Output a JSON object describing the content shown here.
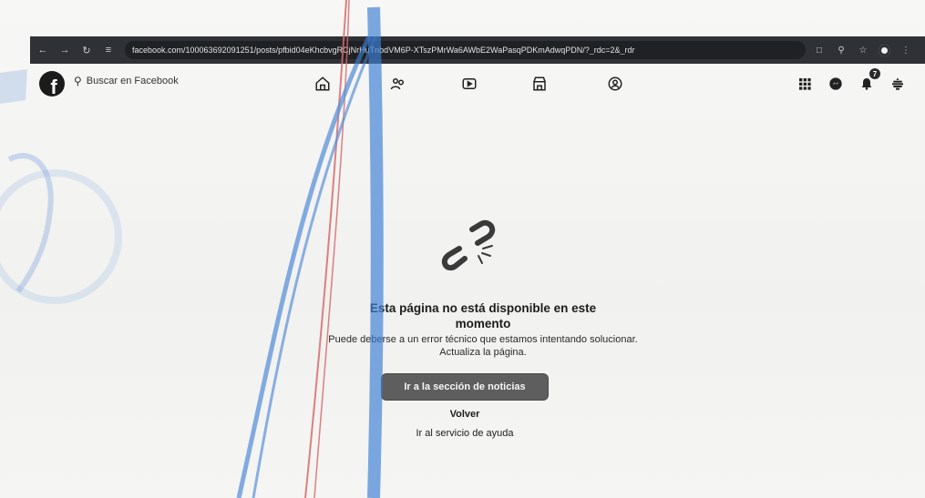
{
  "browser": {
    "url": "facebook.com/100063692091251/posts/pfbid04eKhcbvgRCjNrHuTnbdVM6P-XTszPMrWa6AWbE2WaPasqPDKmAdwqPDN/?_rdc=2&_rdr",
    "back_icon": "back-arrow-icon",
    "forward_icon": "forward-arrow-icon",
    "reload_icon": "reload-icon",
    "site_info_icon": "site-settings-icon",
    "right_icons": [
      "open-in-app-icon",
      "zoom-icon",
      "bookmark-star-icon",
      "profile-icon",
      "menu-icon"
    ]
  },
  "facebook": {
    "logo_letter": "f",
    "search_placeholder": "Buscar en Facebook",
    "nav_icons": [
      "home-icon",
      "friends-icon",
      "video-icon",
      "marketplace-icon",
      "groups-icon"
    ],
    "right_icons": [
      "menu-grid-icon",
      "messenger-icon",
      "notifications-icon",
      "account-icon"
    ],
    "notification_count": "7"
  },
  "error": {
    "icon": "broken-link-icon",
    "title": "Esta página no está disponible en este momento",
    "description": "Puede deberse a un error técnico que estamos intentando solucionar. Actualiza la página.",
    "primary_button": "Ir a la sección de noticias",
    "back_link": "Volver",
    "help_link": "Ir al servicio de ayuda"
  },
  "colors": {
    "chrome_bg": "#2f3136",
    "page_bg": "#f4f4f2",
    "button_bg": "#5e5e5e",
    "blue_ink": "#3f7fd6",
    "red_ink": "#d66b6b"
  }
}
